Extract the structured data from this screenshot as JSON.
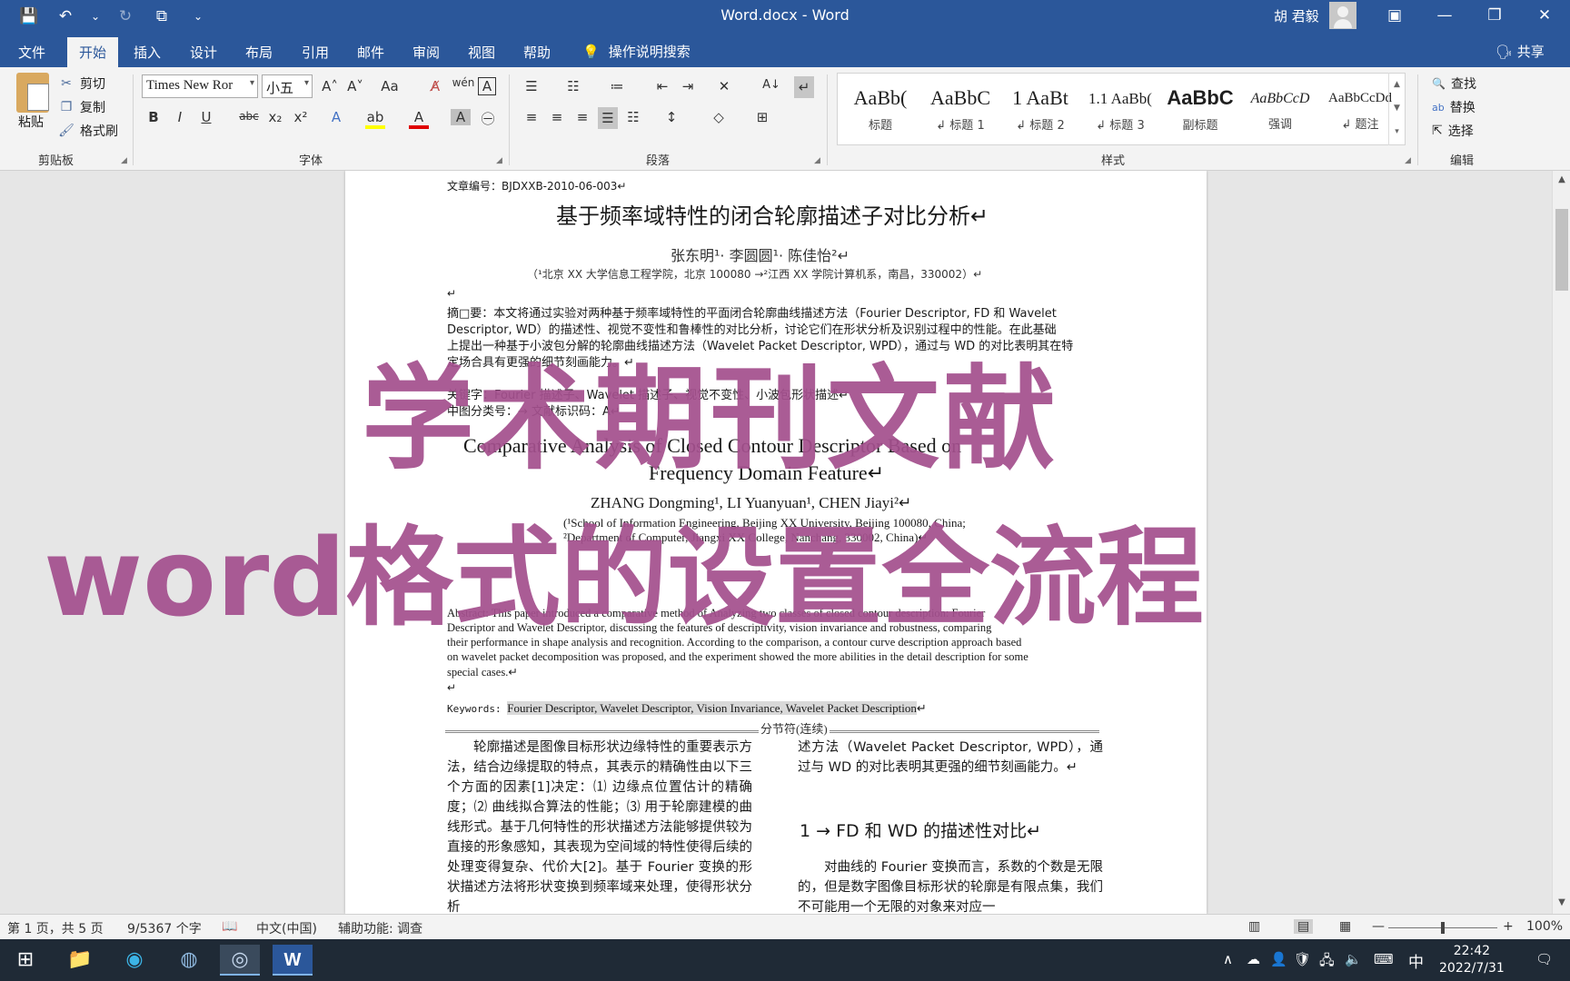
{
  "window": {
    "title": "Word.docx - Word",
    "user": "胡 君毅",
    "minimize": "—",
    "restore": "❐",
    "close": "✕",
    "ribbon_display": "▣"
  },
  "qat": {
    "save": "💾",
    "undo": "↶",
    "undo_drop": "⌄",
    "redo": "↻",
    "format": "⧉",
    "customize": "⌄"
  },
  "tabs": [
    "文件",
    "开始",
    "插入",
    "设计",
    "布局",
    "引用",
    "邮件",
    "审阅",
    "视图",
    "帮助"
  ],
  "active_tab": "开始",
  "tell_me": {
    "icon": "💡",
    "label": "操作说明搜索"
  },
  "share": "🗣 共享",
  "clipboard": {
    "paste": "粘贴",
    "cut": "剪切",
    "copy": "复制",
    "format_painter": "格式刷",
    "label": "剪贴板",
    "cut_icon": "✂",
    "copy_icon": "❐",
    "painter_icon": "🖌"
  },
  "font": {
    "name": "Times New Ror",
    "size": "小五",
    "label": "字体",
    "buttons": {
      "grow": "A˄",
      "shrink": "A˅",
      "case": "Aa",
      "clear": "A̸",
      "phonetic": "wén",
      "border": "A",
      "bold": "B",
      "italic": "I",
      "underline": "U",
      "strike": "abc",
      "sub": "x₂",
      "sup": "x²",
      "effects": "A",
      "highlight": "ab",
      "color": "A",
      "shading": "A",
      "enclose": "㊀"
    }
  },
  "paragraph": {
    "label": "段落",
    "buttons": {
      "bullets": "☰",
      "numbering": "☷",
      "multilevel": "≔",
      "dec_indent": "⇤",
      "inc_indent": "⇥",
      "cjk": "✕",
      "sort": "A↓",
      "marks": "↵",
      "align_left": "≡",
      "center": "≡",
      "align_right": "≡",
      "justify": "☰",
      "distribute": "☷",
      "spacing": "↕",
      "para_shading": "◇",
      "borders": "⊞"
    }
  },
  "styles": {
    "label": "样式",
    "items": [
      {
        "sample": "AaBb(",
        "name": "标题"
      },
      {
        "sample": "AaBbC",
        "name": "↲ 标题 1"
      },
      {
        "sample": "1 AaBt",
        "name": "↲ 标题 2"
      },
      {
        "sample": "1.1 AaBb(",
        "name": "↲ 标题 3"
      },
      {
        "sample": "AaBbC",
        "name": "副标题"
      },
      {
        "sample": "AaBbCcD",
        "name": "强调"
      },
      {
        "sample": "AaBbCcDd",
        "name": "↲ 题注"
      }
    ],
    "scroll_up": "▲",
    "scroll_down": "▼",
    "more": "▾"
  },
  "editing": {
    "label": "编辑",
    "find": "查找",
    "replace": "替换",
    "select": "选择",
    "find_icon": "🔍",
    "replace_icon": "ab",
    "select_icon": "⇱"
  },
  "document": {
    "article_no": "文章编号：BJDXXB-2010-06-003↵",
    "cn_title": "基于频率域特性的闭合轮廓描述子对比分析↵",
    "cn_authors": "张东明¹· 李圆圆¹· 陈佳怡²↵",
    "cn_affil": "（¹北京 XX 大学信息工程学院，北京 100080 →²江西 XX 学院计算机系，南昌，330002）↵",
    "empty1": "↵",
    "cn_abstract_1": "摘□要：本文将通过实验对两种基于频率域特性的平面闭合轮廓曲线描述方法（Fourier Descriptor, FD 和 Wavelet",
    "cn_abstract_2": "Descriptor, WD）的描述性、视觉不变性和鲁棒性的对比分析，讨论它们在形状分析及识别过程中的性能。在此基础",
    "cn_abstract_3": "上提出一种基于小波包分解的轮廓曲线描述方法（Wavelet Packet Descriptor, WPD），通过与 WD 的对比表明其在特",
    "cn_abstract_4": "定场合具有更强的细节刻画能力。↵",
    "cn_keywords": "关键字：Fourier 描述子、Wavelet 描述子、视觉不变性、小波包形状描述↵",
    "cn_class": "中图分类号：→ 文献标识码：A↵",
    "en_title_1": "Comparative Analysis of Closed Contour Descriptor Based on",
    "en_title_2": "Frequency Domain Feature↵",
    "en_authors": "ZHANG Dongming¹, LI Yuanyuan¹, CHEN Jiayi²↵",
    "en_affil_1": "(¹School of Information Engineering, Beijing XX University, Beijing 100080, China;",
    "en_affil_2": "²Department of Computer, Jiangxi XX College, Nanchang, 330002, China)↵",
    "en_abstract_1": "Abstract: This paper introduced a comparative method of Analyzing two classes of closed contour description: Fourier",
    "en_abstract_2": "Descriptor and Wavelet Descriptor, discussing the features of descriptivity, vision invariance and robustness, comparing",
    "en_abstract_3": "their performance in shape analysis and recognition. According to the comparison, a contour curve description approach based",
    "en_abstract_4": "on wavelet packet decomposition was proposed, and the experiment showed the more abilities in the detail description for some",
    "en_abstract_5": "special cases.↵",
    "empty2": "↵",
    "en_kw_label": "Keywords: ",
    "en_kw": "Fourier Descriptor, Wavelet Descriptor, Vision Invariance, Wavelet Packet Description",
    "en_kw_end": "↵",
    "section_break": "分节符(连续)",
    "col1": "轮廓描述是图像目标形状边缘特性的重要表示方法，结合边缘提取的特点，其表示的精确性由以下三个方面的因素[1]决定：⑴ 边缘点位置估计的精确度；⑵ 曲线拟合算法的性能；⑶ 用于轮廓建模的曲线形式。基于几何特性的形状描述方法能够提供较为直接的形象感知，其表现为空间域的特性使得后续的处理变得复杂、代价大[2]。基于 Fourier 变换的形状描述方法将形状变换到频率域来处理，使得形状分析",
    "col2_1": "述方法（Wavelet Packet Descriptor, WPD），通过与 WD 的对比表明其更强的细节刻画能力。↵",
    "col2_heading": "1 → FD 和 WD 的描述性对比↵",
    "col2_2": "对曲线的 Fourier 变换而言，系数的个数是无限的，但是数字图像目标形状的轮廓是有限点集，我们不可能用一个无限的对象来对应一"
  },
  "overlay": {
    "line1": "学术期刊文献",
    "line2": "word格式的设置全流程"
  },
  "status": {
    "page": "第 1 页，共 5 页",
    "words": "9/5367 个字",
    "proof_icon": "📖",
    "language": "中文(中国)",
    "accessibility": "辅助功能: 调查",
    "view_read": "▥",
    "view_print": "▤",
    "view_web": "▦",
    "zoom_out": "—",
    "zoom_in": "+",
    "zoom": "100%"
  },
  "taskbar": {
    "start": "⊞",
    "explorer": "📁",
    "edge": "◉",
    "app3": "◍",
    "app4": "◎",
    "word": "W",
    "tray_chevron": "∧",
    "tray1": "☁",
    "tray2": "👤",
    "tray3": "🛡",
    "network": "🖧",
    "volume": "🔈",
    "keyboard": "⌨",
    "ime": "中",
    "time": "22:42",
    "date": "2022/7/31",
    "notify": "🗨"
  }
}
